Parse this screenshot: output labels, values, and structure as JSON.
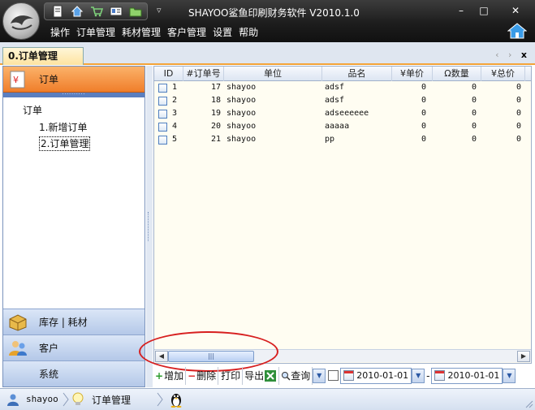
{
  "window": {
    "title": "SHAYOO鲨鱼印刷财务软件 V2010.1.0",
    "controls": {
      "minimize": "–",
      "maximize": "□",
      "close": "✕"
    }
  },
  "menu": [
    "操作",
    "订单管理",
    "耗材管理",
    "客户管理",
    "设置",
    "帮助"
  ],
  "quickbar_icons": [
    "document-icon",
    "home-icon",
    "cart-icon",
    "card-icon",
    "folder-icon"
  ],
  "tab": {
    "label": "0.订单管理",
    "close": "x",
    "nav": "‹ ›"
  },
  "sidebar": {
    "active_group": "订单",
    "tree": {
      "root": "订单",
      "items": [
        "1.新增订单",
        "2.订单管理"
      ]
    },
    "groups": [
      "库存 | 耗材",
      "客户",
      "系统"
    ]
  },
  "grid": {
    "columns": [
      "ID",
      "#订单号",
      "单位",
      "品名",
      "¥单价",
      "Ω数量",
      "¥总价"
    ],
    "rows": [
      {
        "id": "1",
        "order_no": "17",
        "unit": "shayoo",
        "product": "adsf",
        "price": "0",
        "qty": "0",
        "total": "0"
      },
      {
        "id": "2",
        "order_no": "18",
        "unit": "shayoo",
        "product": "adsf",
        "price": "0",
        "qty": "0",
        "total": "0"
      },
      {
        "id": "3",
        "order_no": "19",
        "unit": "shayoo",
        "product": "adseeeeee",
        "price": "0",
        "qty": "0",
        "total": "0"
      },
      {
        "id": "4",
        "order_no": "20",
        "unit": "shayoo",
        "product": "aaaaa",
        "price": "0",
        "qty": "0",
        "total": "0"
      },
      {
        "id": "5",
        "order_no": "21",
        "unit": "shayoo",
        "product": "pp",
        "price": "0",
        "qty": "0",
        "total": "0"
      }
    ]
  },
  "toolbar": {
    "add": "增加",
    "delete": "删除",
    "print": "打印",
    "export": "导出",
    "query": "查询",
    "date_from": "2010-01-01",
    "date_sep": "-",
    "date_to": "2010-01-01"
  },
  "status": {
    "user": "shayoo",
    "module": "订单管理"
  },
  "colors": {
    "accent_orange": "#f07e2a",
    "annotation_red": "#d71f1f",
    "titlebar": "#1d1d1d"
  }
}
